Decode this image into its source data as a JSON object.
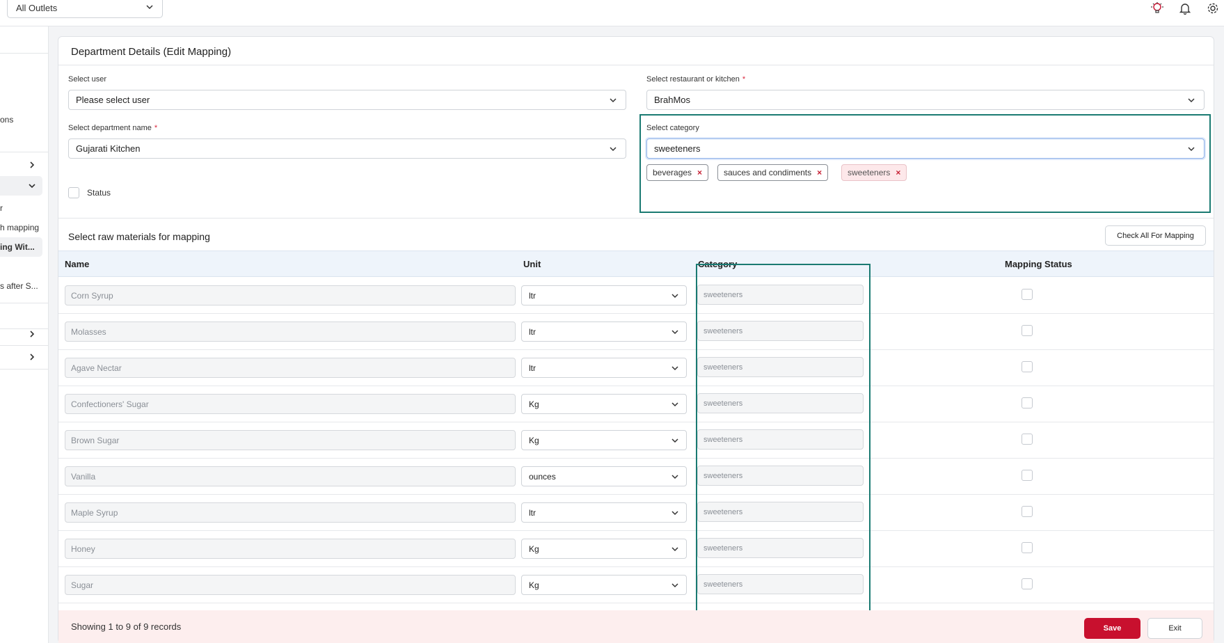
{
  "topbar": {
    "outlet_select": "All Outlets",
    "icons": [
      "lightbulb-icon",
      "bell-icon",
      "gear-icon"
    ]
  },
  "sidebar": {
    "fragments": [
      "ons",
      "r",
      "h mapping",
      "ing Wit...",
      "s after S..."
    ]
  },
  "card": {
    "title": "Department Details (Edit Mapping)",
    "select_user": {
      "label": "Select user",
      "value": "Please select user"
    },
    "select_restaurant": {
      "label": "Select restaurant or kitchen",
      "value": "BrahMos"
    },
    "select_department": {
      "label": "Select department name",
      "value": "Gujarati Kitchen"
    },
    "select_category": {
      "label": "Select category",
      "value": "sweeteners"
    },
    "category_tags": [
      "beverages",
      "sauces and condiments",
      "sweeteners"
    ],
    "status_label": "Status"
  },
  "raw_materials": {
    "title": "Select raw materials for mapping",
    "check_all_label": "Check All For Mapping",
    "columns": {
      "name": "Name",
      "unit": "Unit",
      "category": "Category",
      "status": "Mapping Status"
    },
    "rows": [
      {
        "name": "Corn Syrup",
        "unit": "ltr",
        "category": "sweeteners"
      },
      {
        "name": "Molasses",
        "unit": "ltr",
        "category": "sweeteners"
      },
      {
        "name": "Agave Nectar",
        "unit": "ltr",
        "category": "sweeteners"
      },
      {
        "name": "Confectioners' Sugar",
        "unit": "Kg",
        "category": "sweeteners"
      },
      {
        "name": "Brown Sugar",
        "unit": "Kg",
        "category": "sweeteners"
      },
      {
        "name": "Vanilla",
        "unit": "ounces",
        "category": "sweeteners"
      },
      {
        "name": "Maple Syrup",
        "unit": "ltr",
        "category": "sweeteners"
      },
      {
        "name": "Honey",
        "unit": "Kg",
        "category": "sweeteners"
      },
      {
        "name": "Sugar",
        "unit": "Kg",
        "category": "sweeteners"
      }
    ]
  },
  "footer": {
    "records_text": "Showing 1 to 9 of 9 records",
    "save_label": "Save",
    "exit_label": "Exit"
  },
  "colors": {
    "accent": "#c8102e",
    "highlight": "#1a7a72",
    "table_header": "#eef4fb"
  }
}
